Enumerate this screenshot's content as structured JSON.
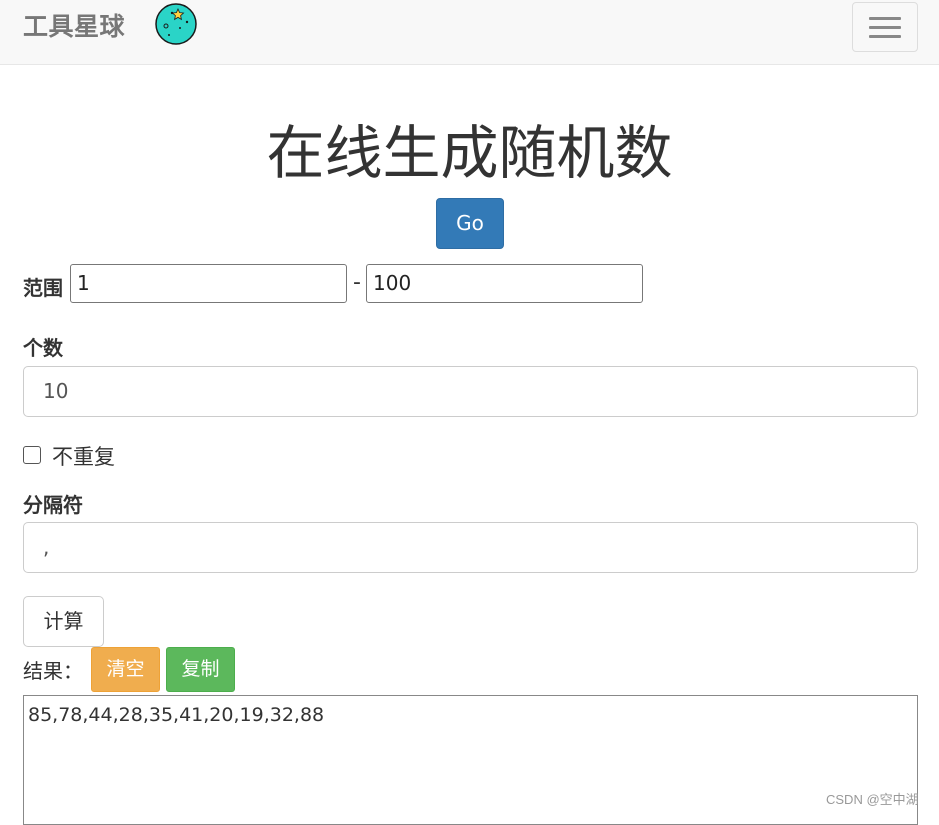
{
  "navbar": {
    "brand": "工具星球",
    "logo_icon": "planet-icon",
    "menu_icon": "hamburger-menu-icon"
  },
  "page": {
    "title": "在线生成随机数",
    "go_label": "Go"
  },
  "form": {
    "range_label": "范围",
    "range_min": "1",
    "range_separator": "-",
    "range_max": "100",
    "count_label": "个数",
    "count_value": "10",
    "unique_label": "不重复",
    "unique_checked": false,
    "separator_label": "分隔符",
    "separator_value": ",",
    "calculate_label": "计算"
  },
  "result": {
    "label": "结果：",
    "clear_label": "清空",
    "copy_label": "复制",
    "value": "85,78,44,28,35,41,20,19,32,88"
  },
  "watermark": "CSDN @空中湖",
  "colors": {
    "primary": "#337ab7",
    "warning": "#f0ad4e",
    "success": "#5cb85c",
    "navbar_bg": "#f8f8f8",
    "logo_fill": "#2ad4c7"
  }
}
